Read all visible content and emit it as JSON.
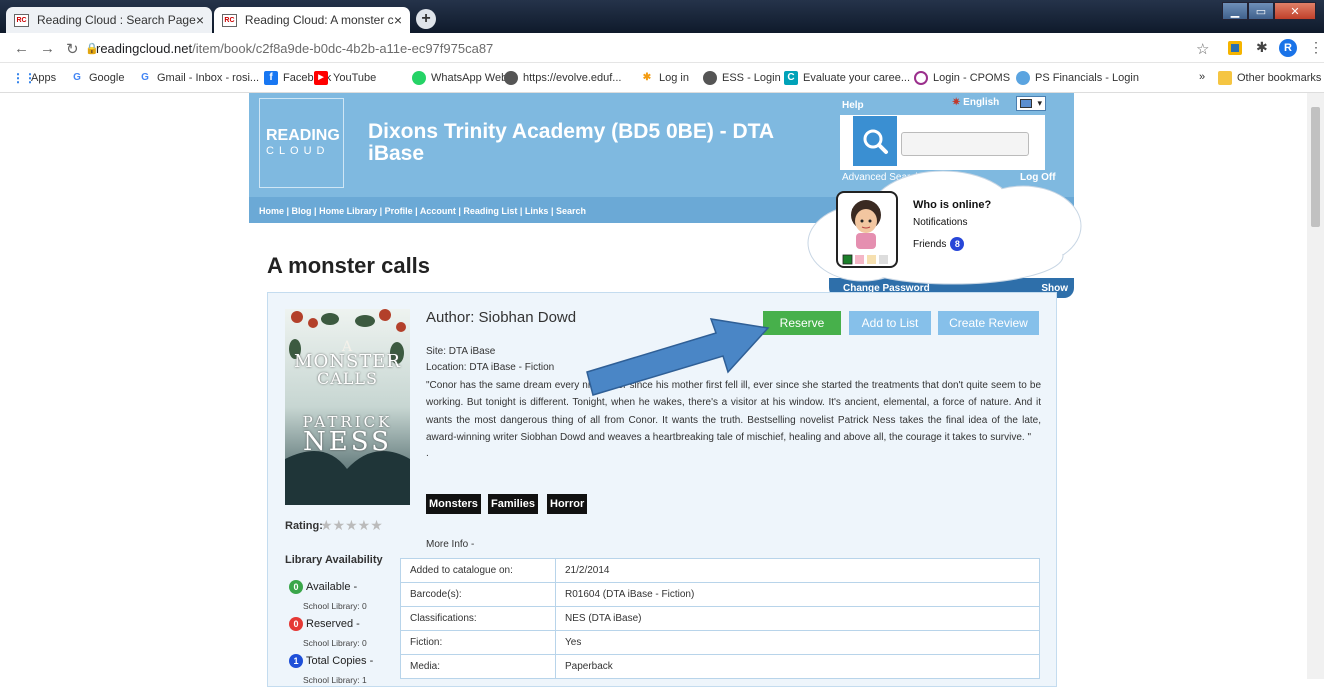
{
  "browser": {
    "tabs": [
      {
        "favicon": "RC",
        "title": "Reading Cloud : Search Page",
        "close": "×"
      },
      {
        "favicon": "RC",
        "title": "Reading Cloud: A monster calls -",
        "close": "×"
      }
    ],
    "new_tab": "+",
    "url_host": "readingcloud.net",
    "url_path": "/item/book/c2f8a9de-b0dc-4b2b-a11e-ec97f975ca87",
    "profile_initial": "R",
    "bookmarks": [
      {
        "label": "Apps",
        "icon": "apps-icon",
        "color": "#1a73e8"
      },
      {
        "label": "Google",
        "icon": "google-icon",
        "color": "#4285f4"
      },
      {
        "label": "Gmail - Inbox - rosi...",
        "icon": "google-icon",
        "color": "#4285f4"
      },
      {
        "label": "Facebook",
        "icon": "facebook-icon",
        "color": "#1877f2"
      },
      {
        "label": "YouTube",
        "icon": "youtube-icon",
        "color": "#ff0000"
      },
      {
        "label": "WhatsApp Web",
        "icon": "whatsapp-icon",
        "color": "#25d366"
      },
      {
        "label": "https://evolve.eduf...",
        "icon": "globe-icon",
        "color": "#555555"
      },
      {
        "label": "Log in",
        "icon": "star-logo-icon",
        "color": "#f39c12"
      },
      {
        "label": "ESS - Login",
        "icon": "globe-icon",
        "color": "#555555"
      },
      {
        "label": "Evaluate your caree...",
        "icon": "c-logo-icon",
        "color": "#00a2b8"
      },
      {
        "label": "Login - CPOMS",
        "icon": "cpoms-icon",
        "color": "#9b2f8c"
      },
      {
        "label": "PS Financials - Login",
        "icon": "ps-icon",
        "color": "#5ba4e0"
      }
    ],
    "bookmarks_overflow": "»",
    "other_bookmarks": "Other bookmarks"
  },
  "site": {
    "logo_line1": "READING",
    "logo_line2": "CLOUD",
    "title": "Dixons Trinity Academy (BD5 0BE) - DTA iBase",
    "help": "Help",
    "language": "English",
    "advanced_search": "Advanced Search",
    "log_off": "Log Off",
    "nav": [
      "Home",
      "Blog",
      "Home Library",
      "Profile",
      "Account",
      "Reading List",
      "Links",
      "Search"
    ],
    "who_online": "Who is online?",
    "notifications": "Notifications",
    "friends": "Friends",
    "friends_count": "8",
    "change_password": "Change Password",
    "show": "Show"
  },
  "book": {
    "page_title": "A monster calls",
    "cover_lines": [
      "A",
      "MONSTER",
      "CALLS",
      "PATRICK",
      "NESS"
    ],
    "author": "Author: Siobhan Dowd",
    "reserve": "Reserve",
    "add_to_list": "Add to List",
    "create_review": "Create Review",
    "site": "Site: DTA iBase",
    "location": "Location: DTA iBase - Fiction",
    "description": "\"Conor has the same dream every night ever since his mother first fell ill, ever since she started the treatments that don't quite seem to be working. But tonight is different. Tonight, when he wakes, there's a visitor at his window. It's ancient, elemental, a force of nature. And it wants the most dangerous thing of all from Conor. It wants the truth. Bestselling novelist Patrick Ness takes the final idea of the late, award-winning writer Siobhan Dowd and weaves a heartbreaking tale of mischief, healing and above all, the courage it takes to survive. \"",
    "desc_dot": ".",
    "tags": [
      "Monsters",
      "Families",
      "Horror"
    ],
    "rating_label": "Rating:",
    "stars": "★★★★★",
    "library_availability": "Library Availability",
    "availability": [
      {
        "count": "0",
        "label": "Available -",
        "sub": "School Library: 0",
        "color": "#3aa64a"
      },
      {
        "count": "0",
        "label": "Reserved -",
        "sub": "School Library: 0",
        "color": "#e53935"
      },
      {
        "count": "1",
        "label": "Total Copies -",
        "sub": "School Library: 1",
        "color": "#1e4fd8"
      }
    ],
    "more_info": "More Info -",
    "info_rows": [
      {
        "key": "Added to catalogue on:",
        "value": "21/2/2014"
      },
      {
        "key": "Barcode(s):",
        "value": "R01604 (DTA iBase - Fiction)"
      },
      {
        "key": "Classifications:",
        "value": "NES (DTA iBase)"
      },
      {
        "key": "Fiction:",
        "value": "Yes"
      },
      {
        "key": "Media:",
        "value": "Paperback"
      }
    ]
  },
  "colors": {
    "header_bg": "#7fb9e0",
    "reserve_green": "#47b04b",
    "light_button": "#86c0ea",
    "arrow": "#3f7fc4"
  }
}
